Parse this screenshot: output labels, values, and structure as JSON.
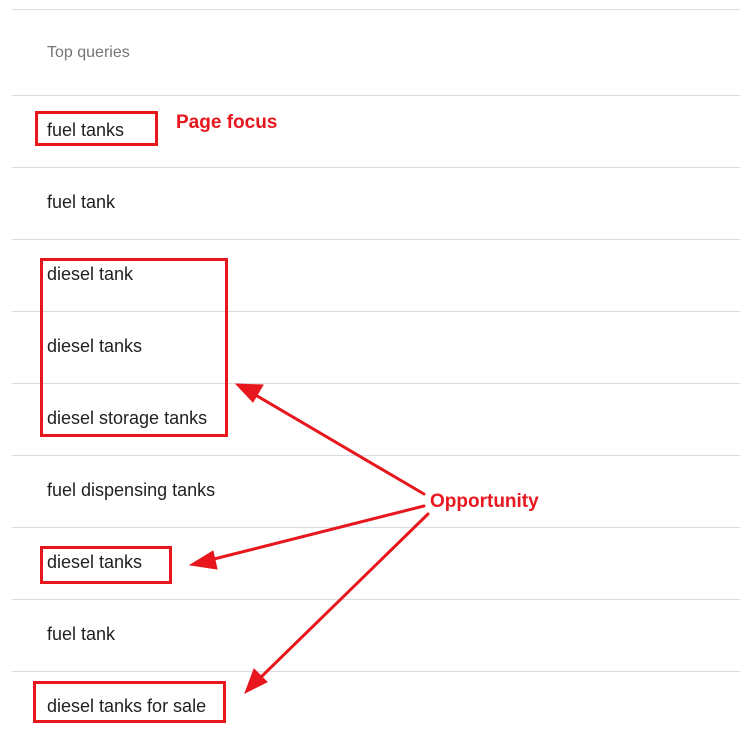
{
  "table": {
    "header": "Top queries",
    "rows": [
      "fuel tanks",
      "fuel tank",
      "diesel tank",
      "diesel tanks",
      "diesel storage tanks",
      "fuel dispensing tanks",
      "diesel tanks",
      "fuel tank",
      "diesel tanks for sale"
    ]
  },
  "annotations": {
    "page_focus_label": "Page focus",
    "opportunity_label": "Opportunity",
    "color": "#e8171e"
  }
}
